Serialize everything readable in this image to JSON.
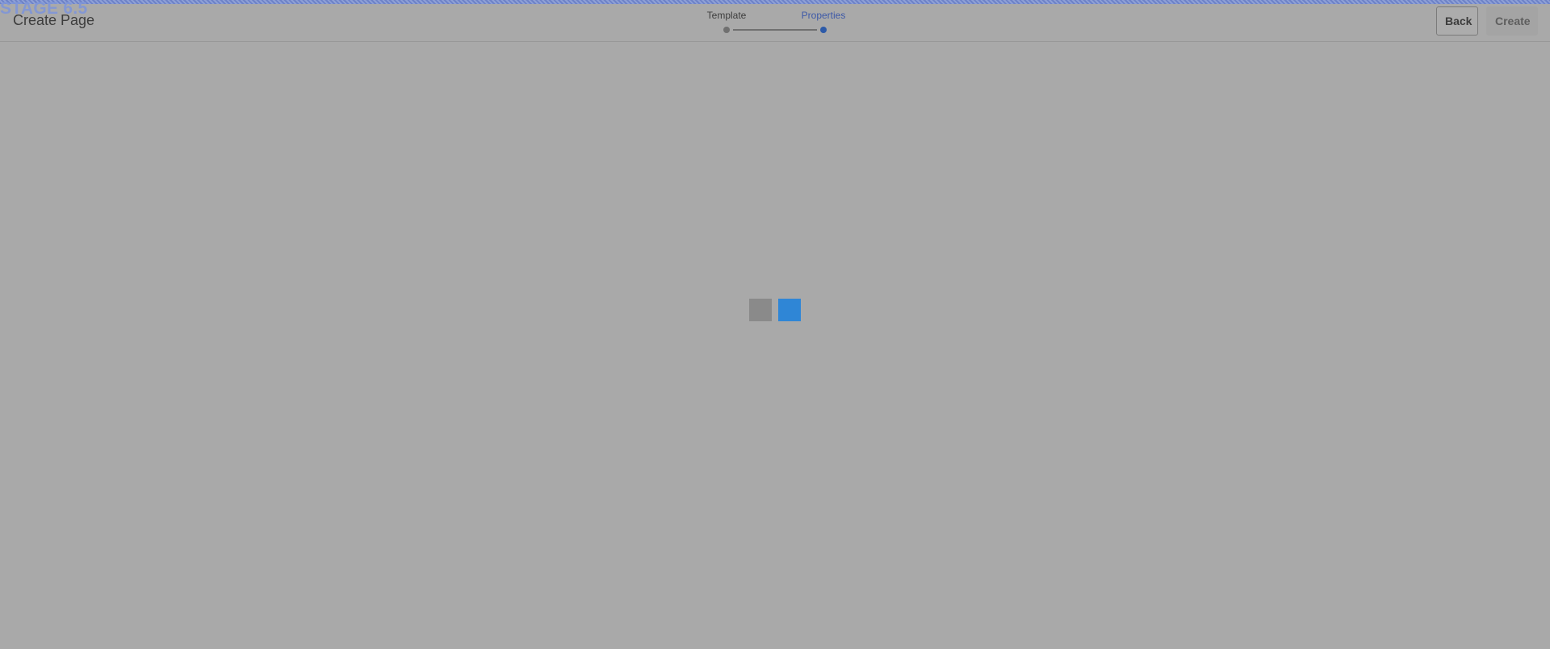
{
  "environment": {
    "label": "STAGE 6.5"
  },
  "header": {
    "title": "Create Page",
    "wizard": {
      "steps": [
        {
          "label": "Template",
          "state": "completed"
        },
        {
          "label": "Properties",
          "state": "current"
        }
      ]
    },
    "actions": {
      "back_label": "Back",
      "create_label": "Create"
    }
  },
  "loader": {
    "icon": "loading-spinner-icon",
    "colors": {
      "primary": "#2f86d6",
      "secondary": "#8a8a8a"
    }
  },
  "colors": {
    "background": "#a9a9a9",
    "accent": "#3d59a8",
    "environment_banner": "#7f96d8"
  }
}
